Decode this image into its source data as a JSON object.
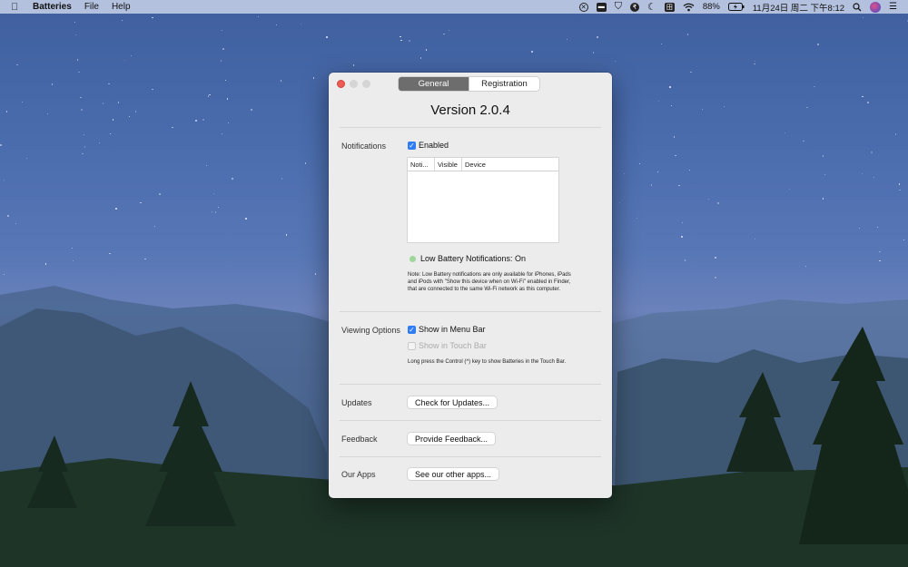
{
  "menubar": {
    "app_name": "Batteries",
    "menus": [
      "File",
      "Help"
    ],
    "battery_percent": "88%",
    "clock": "11月24日 周二 下午8:12",
    "icons": [
      "close-circle-icon",
      "tray-icon",
      "shield-icon",
      "rupee-icon",
      "moon-icon",
      "grid-icon",
      "wifi-icon",
      "battery-icon",
      "search-icon",
      "avatar-icon",
      "list-icon"
    ],
    "grid_glyph": "田"
  },
  "window": {
    "tabs": [
      {
        "label": "General",
        "active": true
      },
      {
        "label": "Registration",
        "active": false
      }
    ],
    "version": "Version 2.0.4",
    "notifications": {
      "label": "Notifications",
      "enabled_label": "Enabled",
      "enabled": true,
      "table_columns": [
        "Noti...",
        "Visible",
        "Device"
      ],
      "status": "Low Battery Notifications: On",
      "status_color": "#9fd79b",
      "note": "Note: Low Battery notifications are only available for iPhones, iPads and iPods with \"Show this device when on Wi-Fi\" enabled in Finder, that are connected to the same Wi-Fi network as this computer."
    },
    "viewing": {
      "label": "Viewing Options",
      "menu_bar_label": "Show in Menu Bar",
      "menu_bar_checked": true,
      "touch_bar_label": "Show in Touch Bar",
      "touch_bar_checked": false,
      "note": "Long press the Control (^) key to show Batteries in the Touch Bar."
    },
    "updates": {
      "label": "Updates",
      "button": "Check for Updates..."
    },
    "feedback": {
      "label": "Feedback",
      "button": "Provide Feedback..."
    },
    "apps": {
      "label": "Our Apps",
      "button": "See our other apps..."
    }
  }
}
